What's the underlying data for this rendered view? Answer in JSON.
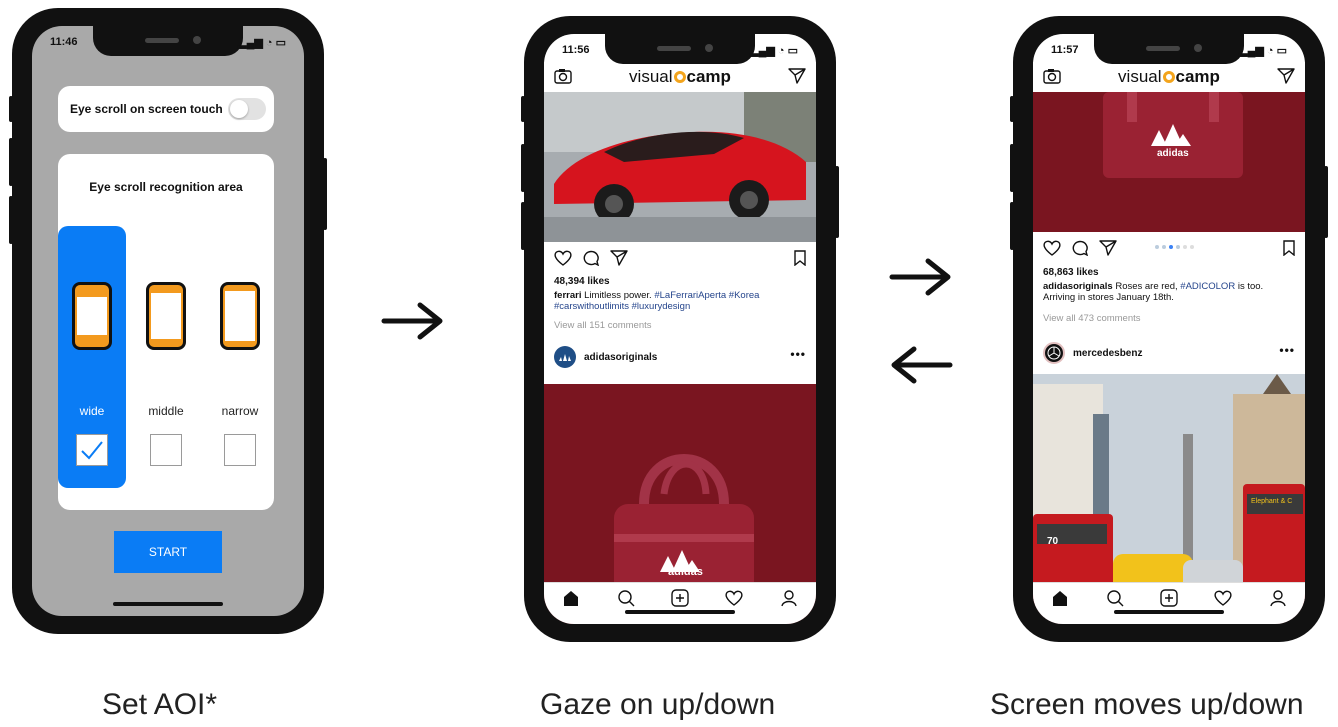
{
  "phones": [
    {
      "time": "11:46",
      "toggle_label": "Eye scroll on screen touch",
      "area_title": "Eye scroll recognition area",
      "options": [
        {
          "label": "wide",
          "selected": true
        },
        {
          "label": "middle",
          "selected": false
        },
        {
          "label": "narrow",
          "selected": false
        }
      ],
      "start_label": "START"
    },
    {
      "time": "11:56",
      "brand_pre": "visual",
      "brand_post": "camp",
      "likes": "48,394 likes",
      "caption_user": "ferrari",
      "caption_text": " Limitless power. ",
      "caption_tags": "#LaFerrariAperta #Korea #carswithoutlimits #luxurydesign",
      "comments": "View all 151 comments",
      "next_user": "adidasoriginals",
      "product_brand": "adidas"
    },
    {
      "time": "11:57",
      "brand_pre": "visual",
      "brand_post": "camp",
      "likes": "68,863 likes",
      "caption_user": "adidasoriginals",
      "caption_text": " Roses are red, ",
      "caption_tag": "#ADICOLOR",
      "caption_end": " is too. Arriving in stores January 18th.",
      "comments": "View all 473 comments",
      "next_user": "mercedesbenz",
      "product_brand": "adidas",
      "bus_label": "70",
      "bus_sign": "Elephant & C"
    }
  ],
  "captions": [
    "Set AOI*",
    "Gaze on up/down",
    "Screen moves up/down"
  ],
  "colors": {
    "accent": "#0a7cf5",
    "brand_pin": "#f3a41c",
    "adidas_red": "#7a1520",
    "ferrari_red": "#d6141e"
  }
}
